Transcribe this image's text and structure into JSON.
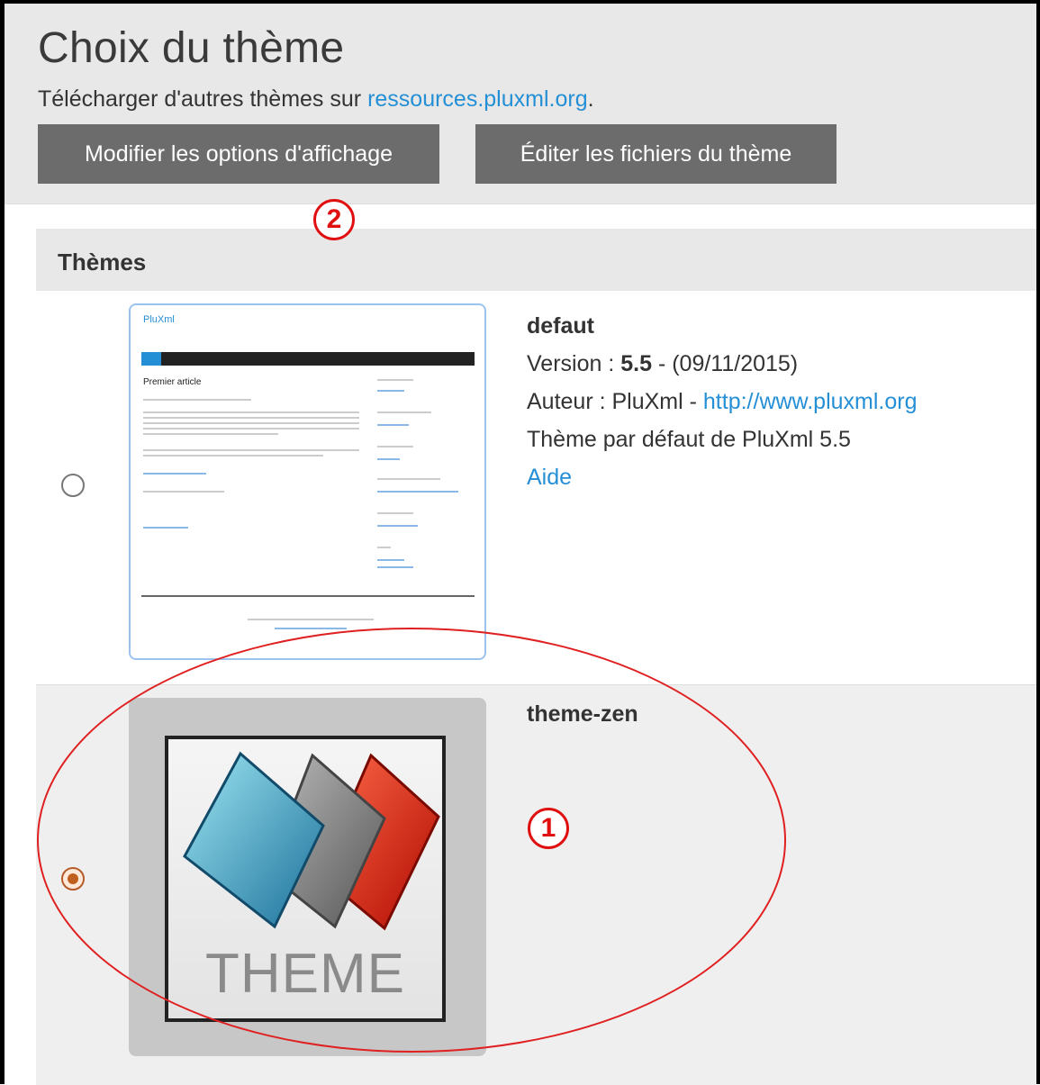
{
  "header": {
    "title": "Choix du thème",
    "subtitle_prefix": "Télécharger d'autres thèmes sur ",
    "subtitle_link": "ressources.pluxml.org",
    "subtitle_suffix": ".",
    "buttons": {
      "options": "Modifier les options d'affichage",
      "edit": "Éditer les fichiers du thème"
    }
  },
  "callouts": {
    "one": "1",
    "two": "2"
  },
  "panel": {
    "title": "Thèmes",
    "themes": [
      {
        "name": "defaut",
        "selected": false,
        "version_label": "Version : ",
        "version": "5.5",
        "date": " - (09/11/2015)",
        "author_label": "Auteur : PluXml - ",
        "author_url": "http://www.pluxml.org",
        "description": "Thème par défaut de PluXml 5.5",
        "help": "Aide",
        "preview": {
          "site_title": "PluXml",
          "article_title": "Premier article"
        }
      },
      {
        "name": "theme-zen",
        "selected": true,
        "thumbnail_text": "THEME"
      }
    ]
  },
  "colors": {
    "link": "#258fd6",
    "button_bg": "#6c6c6c",
    "annotation": "#e01010",
    "header_bg": "#e8e8e8"
  }
}
